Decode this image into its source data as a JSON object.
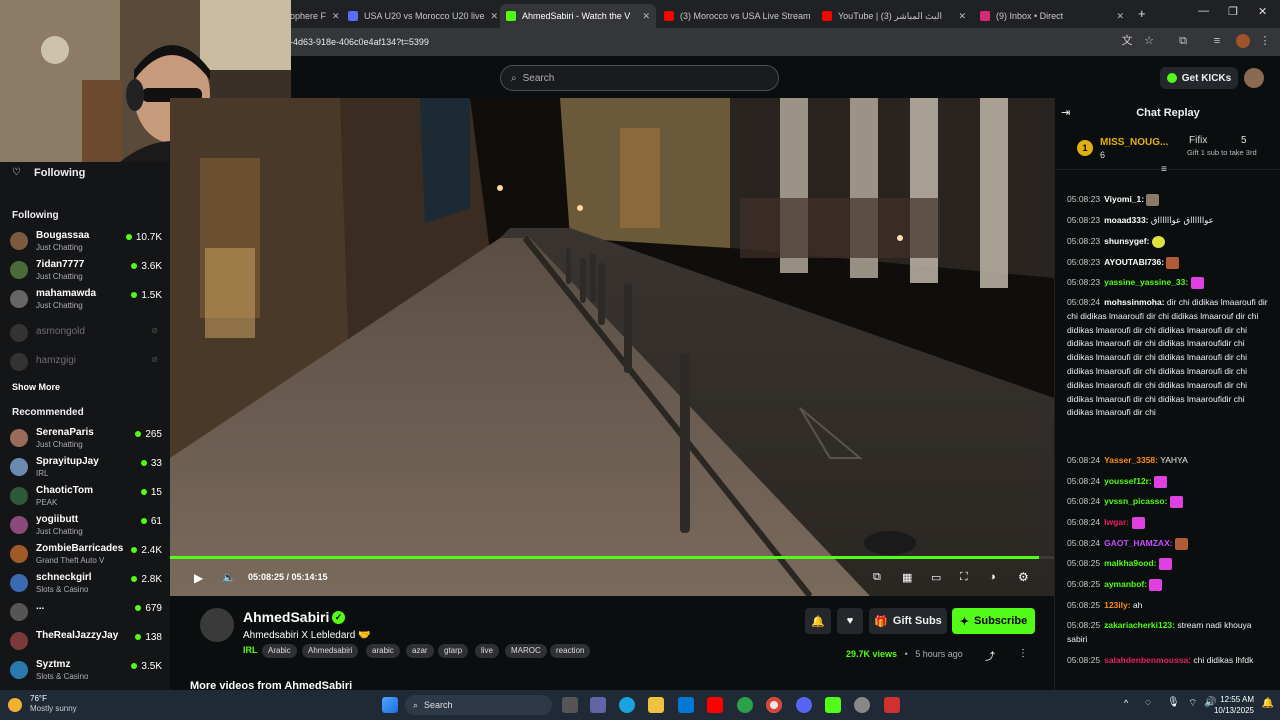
{
  "browser": {
    "tabs": [
      {
        "label": "ophere F",
        "fav_color": "#888"
      },
      {
        "label": "USA U20 vs Morocco U20 live",
        "fav_color": "#5b6cf5"
      },
      {
        "label": "AhmedSabiri - Watch the V",
        "fav_color": "#53fc18"
      },
      {
        "label": "(3) Morocco vs USA Live Stream",
        "fav_color": "#ff0000"
      },
      {
        "label": "YouTube | البث المباشر (3)",
        "fav_color": "#ff0000"
      },
      {
        "label": "(9) Inbox • Direct",
        "fav_color": "#d62976"
      }
    ],
    "new_tab": "+",
    "url": "-4d63-918e-406c0e4af134?t=5399"
  },
  "kick_header": {
    "search_placeholder": "Search",
    "get_kicks": "Get KICKs"
  },
  "sidebar": {
    "following_header": "Following",
    "following_section": "Following",
    "following": [
      {
        "name": "Bougassaa",
        "category": "Just Chatting",
        "viewers": "10.7K"
      },
      {
        "name": "7idan7777",
        "category": "Just Chatting",
        "viewers": "3.6K"
      },
      {
        "name": "mahamawda",
        "category": "Just Chatting",
        "viewers": "1.5K"
      },
      {
        "name": "asmongold",
        "category": "",
        "viewers": ""
      },
      {
        "name": "hamzgigi",
        "category": "",
        "viewers": ""
      }
    ],
    "show_more": "Show More",
    "recommended_section": "Recommended",
    "recommended": [
      {
        "name": "SerenaParis",
        "category": "Just Chatting",
        "viewers": "265"
      },
      {
        "name": "SprayitupJay",
        "category": "IRL",
        "viewers": "33"
      },
      {
        "name": "ChaoticTom",
        "category": "PEAK",
        "viewers": "15"
      },
      {
        "name": "yogiibutt",
        "category": "Just Chatting",
        "viewers": "61"
      },
      {
        "name": "ZombieBarricades",
        "category": "Grand Theft Auto V",
        "viewers": "2.4K"
      },
      {
        "name": "schneckgirl",
        "category": "Slots & Casino",
        "viewers": "2.8K"
      },
      {
        "name": "...",
        "category": "",
        "viewers": "679"
      },
      {
        "name": "TheRealJazzyJay",
        "category": "",
        "viewers": "138"
      },
      {
        "name": "Syztmz",
        "category": "Slots & Casino",
        "viewers": "3.5K"
      }
    ]
  },
  "player": {
    "time": "05:08:25 / 05:14:15",
    "progress_fraction": 0.983
  },
  "stream": {
    "name": "AhmedSabiri",
    "title": "Ahmedsabiri X Lebledard 🤝",
    "category": "IRL",
    "tags": [
      "Arabic",
      "Ahmedsabiri",
      "arabic",
      "azar",
      "gtarp",
      "live",
      "MAROC",
      "reaction"
    ],
    "gift_subs": "Gift Subs",
    "subscribe": "Subscribe",
    "views": "29.7K views",
    "ago": "5 hours ago",
    "more_videos": "More videos from AhmedSabiri"
  },
  "chat": {
    "header": "Chat Replay",
    "gifters": [
      {
        "rank": "1",
        "name": "MISS_NOUG...",
        "count": "6"
      },
      {
        "name": "Fifix",
        "count": "5",
        "note": "Gift 1 sub to take 3rd"
      }
    ],
    "messages": [
      {
        "time": "05:08:23",
        "user": "Viyomi_1:",
        "color": "#ffffff",
        "text": ""
      },
      {
        "time": "05:08:23",
        "user": "moaad333:",
        "color": "#ffffff",
        "text": "عوااااااق عوااااااق"
      },
      {
        "time": "05:08:23",
        "user": "shunsygef:",
        "color": "#ffffff",
        "text": ""
      },
      {
        "time": "05:08:23",
        "user": "AYOUTABI736:",
        "color": "#ffffff",
        "text": ""
      },
      {
        "time": "05:08:23",
        "user": "yassine_yassine_33:",
        "color": "#53fc18",
        "text": ""
      },
      {
        "time": "05:08:24",
        "user": "mohssinmoha:",
        "color": "#ffffff",
        "text": "dir chi didikas lmaaroufi dir chi didikas lmaaroufi dir chi didikas lmaarouf dir chi didikas lmaaroufi dir chi didikas lmaaroufi dir chi didikas lmaaroufi dir chi didikas lmaaroufidir chi didikas lmaaroufi dir chi didikas lmaaroufi dir chi didikas lmaaroufi dir chi didikas lmaaroufi dir chi didikas lmaaroufi dir chi didikas lmaaroufi dir chi didikas lmaaroufi dir chi didikas lmaaroufidir chi didikas lmaaroufi dir chi"
      },
      {
        "time": "05:08:24",
        "user": "Yasser_3358:",
        "color": "#ff8c1a",
        "text": "YAHYA"
      },
      {
        "time": "05:08:24",
        "user": "youssef12r:",
        "color": "#53fc18",
        "text": ""
      },
      {
        "time": "05:08:24",
        "user": "yvssn_picasso:",
        "color": "#53fc18",
        "text": ""
      },
      {
        "time": "05:08:24",
        "user": "Iwgar:",
        "color": "#e91e63",
        "text": ""
      },
      {
        "time": "05:08:24",
        "user": "GAOT_HAMZAX:",
        "color": "#c84bff",
        "text": ""
      },
      {
        "time": "05:08:25",
        "user": "malkha9ood:",
        "color": "#53fc18",
        "text": ""
      },
      {
        "time": "05:08:25",
        "user": "aymanbof:",
        "color": "#53fc18",
        "text": ""
      },
      {
        "time": "05:08:25",
        "user": "123ily:",
        "color": "#ff8c1a",
        "text": "ah"
      },
      {
        "time": "05:08:25",
        "user": "zakariacherki123:",
        "color": "#53fc18",
        "text": "stream nadi khouya sabiri"
      },
      {
        "time": "05:08:25",
        "user": "salahdenbenmoussa:",
        "color": "#e91e63",
        "text": "chi didikas lhfdk"
      }
    ]
  },
  "taskbar": {
    "weather_temp": "76°F",
    "weather_desc": "Mostly sunny",
    "search": "Search",
    "time": "12:55 AM",
    "date": "10/13/2025"
  },
  "colors": {
    "accent": "#53fc18",
    "bg": "#0b0e0f",
    "panel": "#141517"
  }
}
